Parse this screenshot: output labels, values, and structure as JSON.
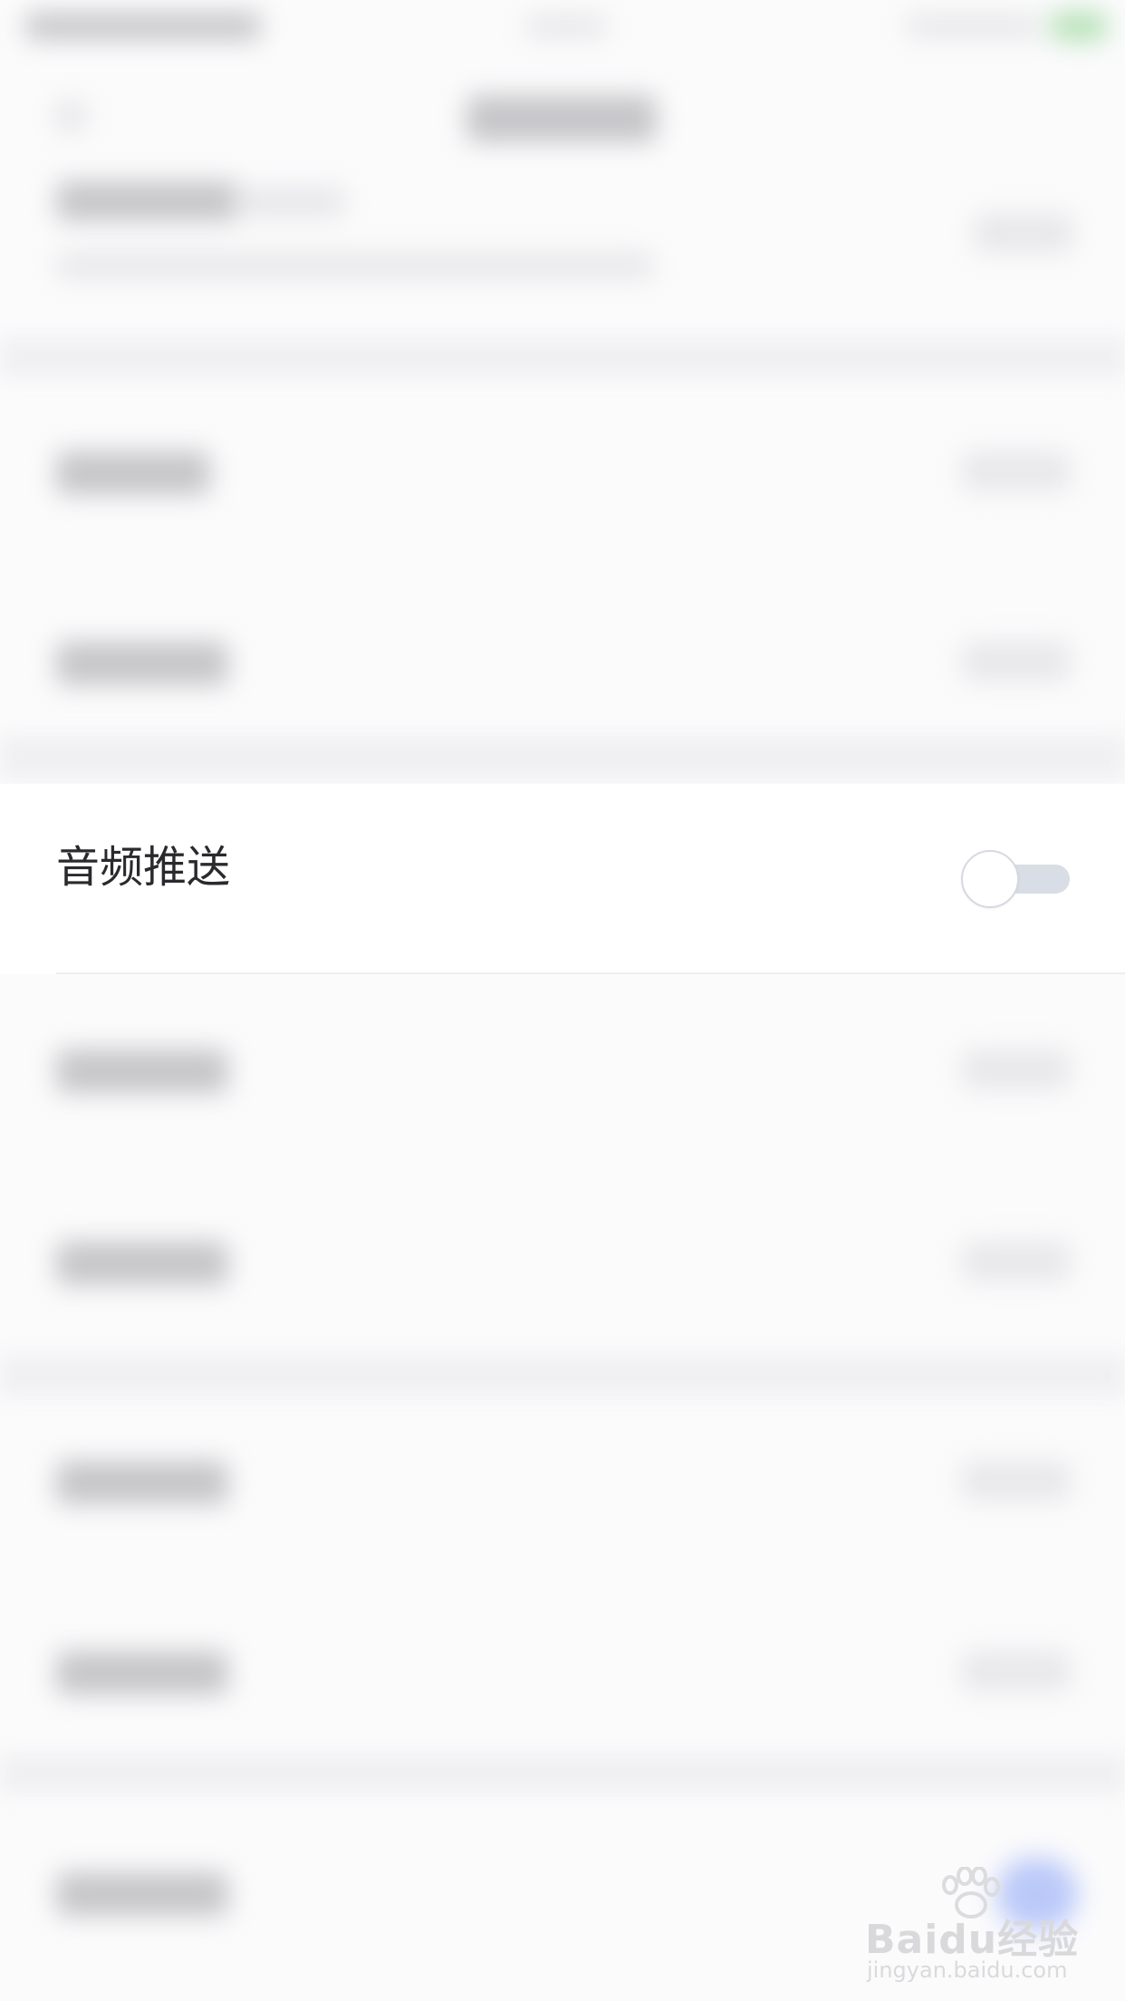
{
  "settings": {
    "audio_push": {
      "label": "音频推送",
      "enabled": false
    }
  },
  "colors": {
    "toggle_track_off": "#d9dde6",
    "toggle_knob": "#ffffff",
    "label_text": "#2a2a2e"
  },
  "watermark": {
    "brand": "Baidu经验",
    "url": "jingyan.baidu.com"
  }
}
